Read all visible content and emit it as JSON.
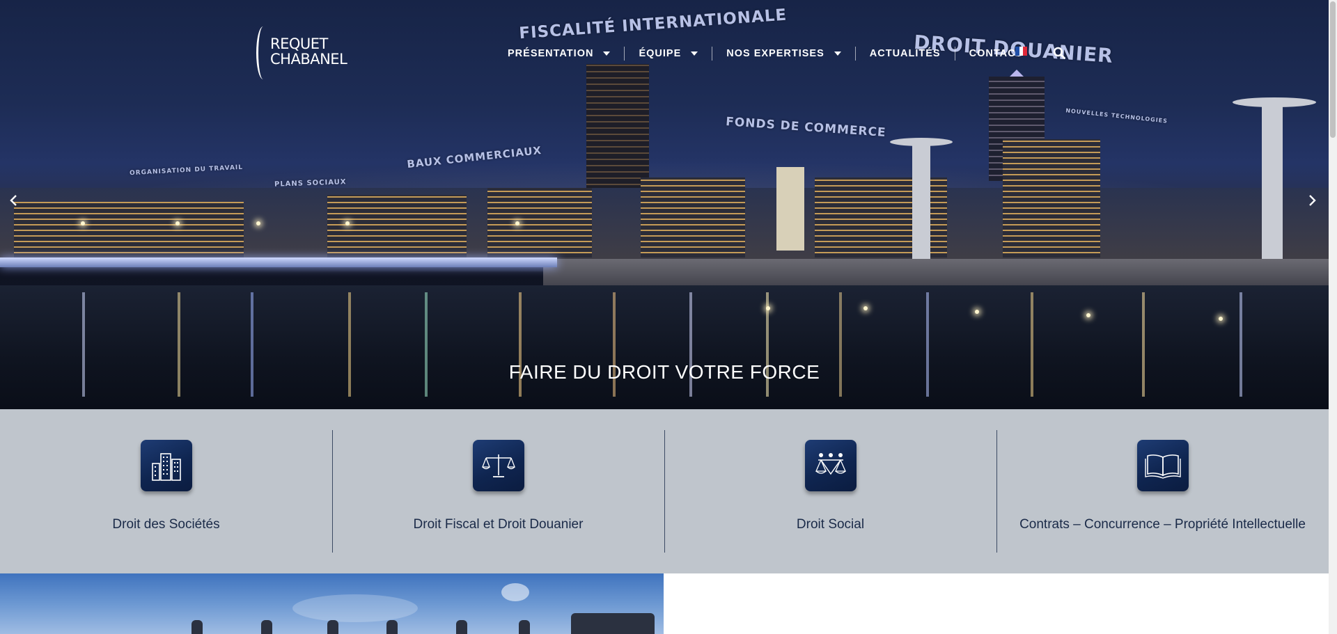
{
  "logo": {
    "line1": "REQUET",
    "line2": "CHABANEL"
  },
  "nav": {
    "items": [
      {
        "label": "PRÉSENTATION",
        "has_dropdown": true
      },
      {
        "label": "ÉQUIPE",
        "has_dropdown": true
      },
      {
        "label": "NOS EXPERTISES",
        "has_dropdown": true
      },
      {
        "label": "ACTUALITÉS",
        "has_dropdown": false
      },
      {
        "label": "CONTACT",
        "has_dropdown": false
      }
    ],
    "language_flag": "flag-fr-icon",
    "search_icon": "search-icon"
  },
  "hero": {
    "floating_labels": {
      "fiscalite": "FISCALITÉ INTERNATIONALE",
      "douanier": "DROIT DOUANIER",
      "fonds": "FONDS DE COMMERCE",
      "baux": "BAUX COMMERCIAUX",
      "organisation": "ORGANISATION DU TRAVAIL",
      "plans": "PLANS SOCIAUX",
      "nouvelles": "NOUVELLES TECHNOLOGIES"
    },
    "tagline": "FAIRE DU DROIT VOTRE FORCE",
    "prev_icon": "chevron-left-icon",
    "next_icon": "chevron-right-icon"
  },
  "expertises": [
    {
      "label": "Droit des Sociétés",
      "icon": "buildings-icon"
    },
    {
      "label": "Droit Fiscal et Droit Douanier",
      "icon": "scales-icon"
    },
    {
      "label": "Droit Social",
      "icon": "people-scales-icon"
    },
    {
      "label": "Contrats – Concurrence – Propriété Intellectuelle",
      "icon": "open-book-icon"
    }
  ],
  "colors": {
    "hero_night": "#1d2c55",
    "band_bg": "#bfc5cc",
    "icon_bg": "#0f2550",
    "label_text": "#1a2a48"
  }
}
